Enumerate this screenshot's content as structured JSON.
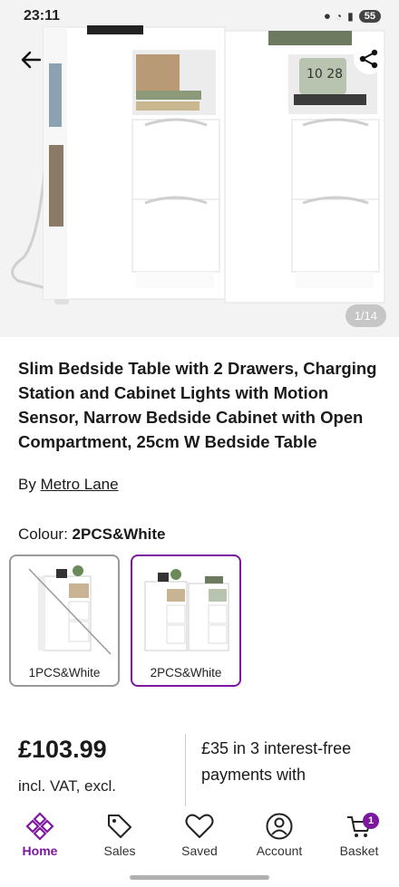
{
  "status_bar": {
    "time": "23:11",
    "battery": "55"
  },
  "hero": {
    "pager": "1/14"
  },
  "product": {
    "title": "Slim Bedside Table with 2 Drawers, Charging Station and Cabinet Lights with Motion Sensor, Narrow Bedside Cabinet with Open Compartment, 25cm W Bedside Table",
    "by_prefix": "By",
    "brand": "Metro Lane",
    "colour_prefix": "Colour:",
    "colour_value": "2PCS&White",
    "swatches": [
      {
        "label": "1PCS&White",
        "selected": false,
        "available": false
      },
      {
        "label": "2PCS&White",
        "selected": true,
        "available": true
      }
    ],
    "price": "£103.99",
    "vat_line1": "incl. VAT, excl.",
    "finance": "£35 in 3 interest-free payments with"
  },
  "nav": {
    "items": [
      {
        "label": "Home",
        "icon": "home-icon",
        "active": true
      },
      {
        "label": "Sales",
        "icon": "tag-icon",
        "active": false
      },
      {
        "label": "Saved",
        "icon": "heart-icon",
        "active": false
      },
      {
        "label": "Account",
        "icon": "account-icon",
        "active": false
      },
      {
        "label": "Basket",
        "icon": "basket-icon",
        "active": false,
        "badge": "1"
      }
    ]
  },
  "colors": {
    "accent": "#7b189f"
  }
}
